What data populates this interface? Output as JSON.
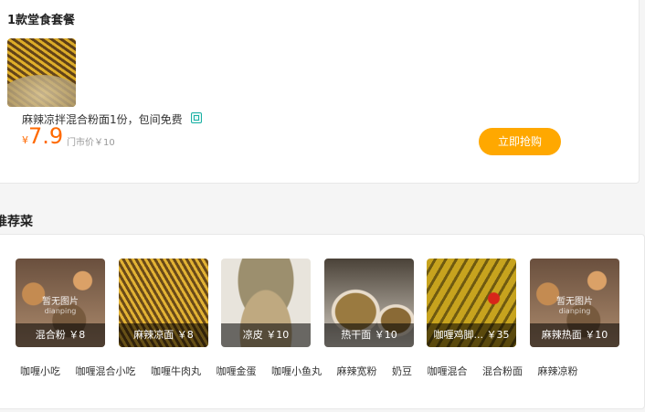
{
  "deal": {
    "title": "1款堂食套餐",
    "name": "麻辣凉拌混合粉面1份，包间免费",
    "price_symbol": "¥",
    "price": "7.9",
    "original_price": "门市价￥10",
    "buy_label": "立即抢购"
  },
  "recommend": {
    "title": "推荐菜",
    "no_image_text": "暂无图片",
    "no_image_sub": "dianping",
    "dishes": [
      {
        "caption": "混合粉 ￥8"
      },
      {
        "caption": "麻辣凉面 ￥8"
      },
      {
        "caption": "凉皮 ￥10"
      },
      {
        "caption": "热干面 ￥10"
      },
      {
        "caption": "咖喱鸡脚... ￥35"
      },
      {
        "caption": "麻辣热面 ￥10"
      }
    ],
    "tags": [
      "咖喱小吃",
      "咖喱混合小吃",
      "咖喱牛肉丸",
      "咖喱金蛋",
      "咖喱小鱼丸",
      "麻辣宽粉",
      "奶豆",
      "咖喱混合",
      "混合粉面",
      "麻辣凉粉"
    ]
  },
  "colors": {
    "accent": "#ff6a00",
    "button": "#ffa800",
    "tag_icon": "#19b0a4"
  }
}
